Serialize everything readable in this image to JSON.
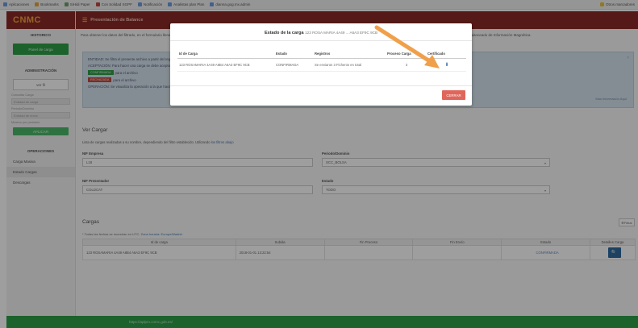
{
  "bookmarks": {
    "items": [
      {
        "label": "Aplicaciones",
        "color": "#6d9be0"
      },
      {
        "label": "Bookmarks",
        "color": "#e8a33b"
      },
      {
        "label": "SiHidi Paper",
        "color": "#6aa36a"
      },
      {
        "label": "Con Solidad SGPF",
        "color": "#c44a3f"
      },
      {
        "label": "Notificación",
        "color": "#6d9be0"
      },
      {
        "label": "Analistas plan Plan",
        "color": "#6d9be0"
      },
      {
        "label": "dianna.gog.mx.admin",
        "color": "#6d9be0"
      }
    ],
    "right_label": "Otros marcadores"
  },
  "sidebar": {
    "logo": "CNMC",
    "section1": "HISTORICO",
    "btn1": "Panel de carga",
    "section2": "ADMINISTRACIÓN",
    "box": "ver fil",
    "lbl1": "Consultar Carga",
    "field1": "Entidad de carga",
    "lbl2": "Periodo/Dominio",
    "field2": "Entidad de envio",
    "lbl3": "Mostrar por periodos",
    "btn2": "APLICAR",
    "section3": "OPERACIONES",
    "items": [
      "Carga Masiva",
      "Estado Cargas",
      "Descargas"
    ]
  },
  "topbar": {
    "title": "Presentación de Balance"
  },
  "main": {
    "subtitle": "Para obtener los datos del filtrado, en el formulario llenar la información para consultar la carga de sus datos.",
    "subtitle2": "Datos de carga del Sistema Balanceado de Información Magnética.",
    "info": {
      "line1": "ENTIDAD: Se filtra el presente archivo a partir del registro cargado, con las tablas de la serie ...",
      "line2": "ACEPTACIÓN: Para hacer una carga se debe aceptar el registro de informe.",
      "tag_green": "CONFIRMADA",
      "line3": "para el archivo",
      "tag_red": "RECHAZADA",
      "line4": "para el archivo",
      "line5": "OPERACIÓN: Se visualiza la operación a la que hace referencia el registro.",
      "close": "×",
      "link": "Mas Información Aquí"
    },
    "form_title": "Ver Cargar",
    "hint": "Lista de cargas realizadas a su nombre, dependiendo del filtro establecido. Utilizando",
    "hint_link": "los filtros abajo",
    "nif_label": "NIF Empresa",
    "nif_value": "L18",
    "periodo_label": "Periodo/Dominio",
    "periodo_value": "SCC_BOLSA",
    "nif_pres_label": "NIF Presentador",
    "nif_pres_value": "COLDCAT",
    "estado_label": "Estado",
    "estado_value": "TODO",
    "cargas_title": "Cargas",
    "filtro": "Filtrar",
    "grid_hint": "* Todas las fechas se muestran en UTC.",
    "grid_hint_link": "Zona horaria: Europe/Madrid",
    "columns": [
      "Id de carga",
      "Subida",
      "Fin Proceso",
      "Fin Envío",
      "Estado",
      "Detalles Carga"
    ],
    "rows": [
      {
        "id": "123 ROSAMARIA 4A49 A8B4 A6A3 EF9C 9CB",
        "subida": "2018-01-01 13:22:54",
        "fin_proceso": "",
        "fin_envio": "",
        "estado": "CONFIRMADA",
        "detalle": "🔍"
      }
    ]
  },
  "footer": {
    "url": "https://aplpro.cnmc.gob.es/"
  },
  "modal": {
    "title_bold": "Estado de la carga",
    "title_rest": "123 ROSA MARIA 4A49 ... A6A3 EF9C 9CB",
    "columns": [
      "Id de Carga",
      "Estado",
      "Registros",
      "Proceso Carga",
      "Certificado"
    ],
    "rows": [
      {
        "id": "123 ROSAMARIA 4A49 A8B4 A6A3 EF9C 9CB",
        "estado": "CONFIRMADA",
        "registros": "Se enviaron 3 Ficheros en total",
        "proceso": "3",
        "cert": "⬇"
      }
    ],
    "close": "CERRAR"
  },
  "colors": {
    "brand": "#8a2b26",
    "accent": "#f2a23c",
    "success": "#2e9e48",
    "danger": "#e0665c",
    "arrow": "#f0a04b"
  }
}
